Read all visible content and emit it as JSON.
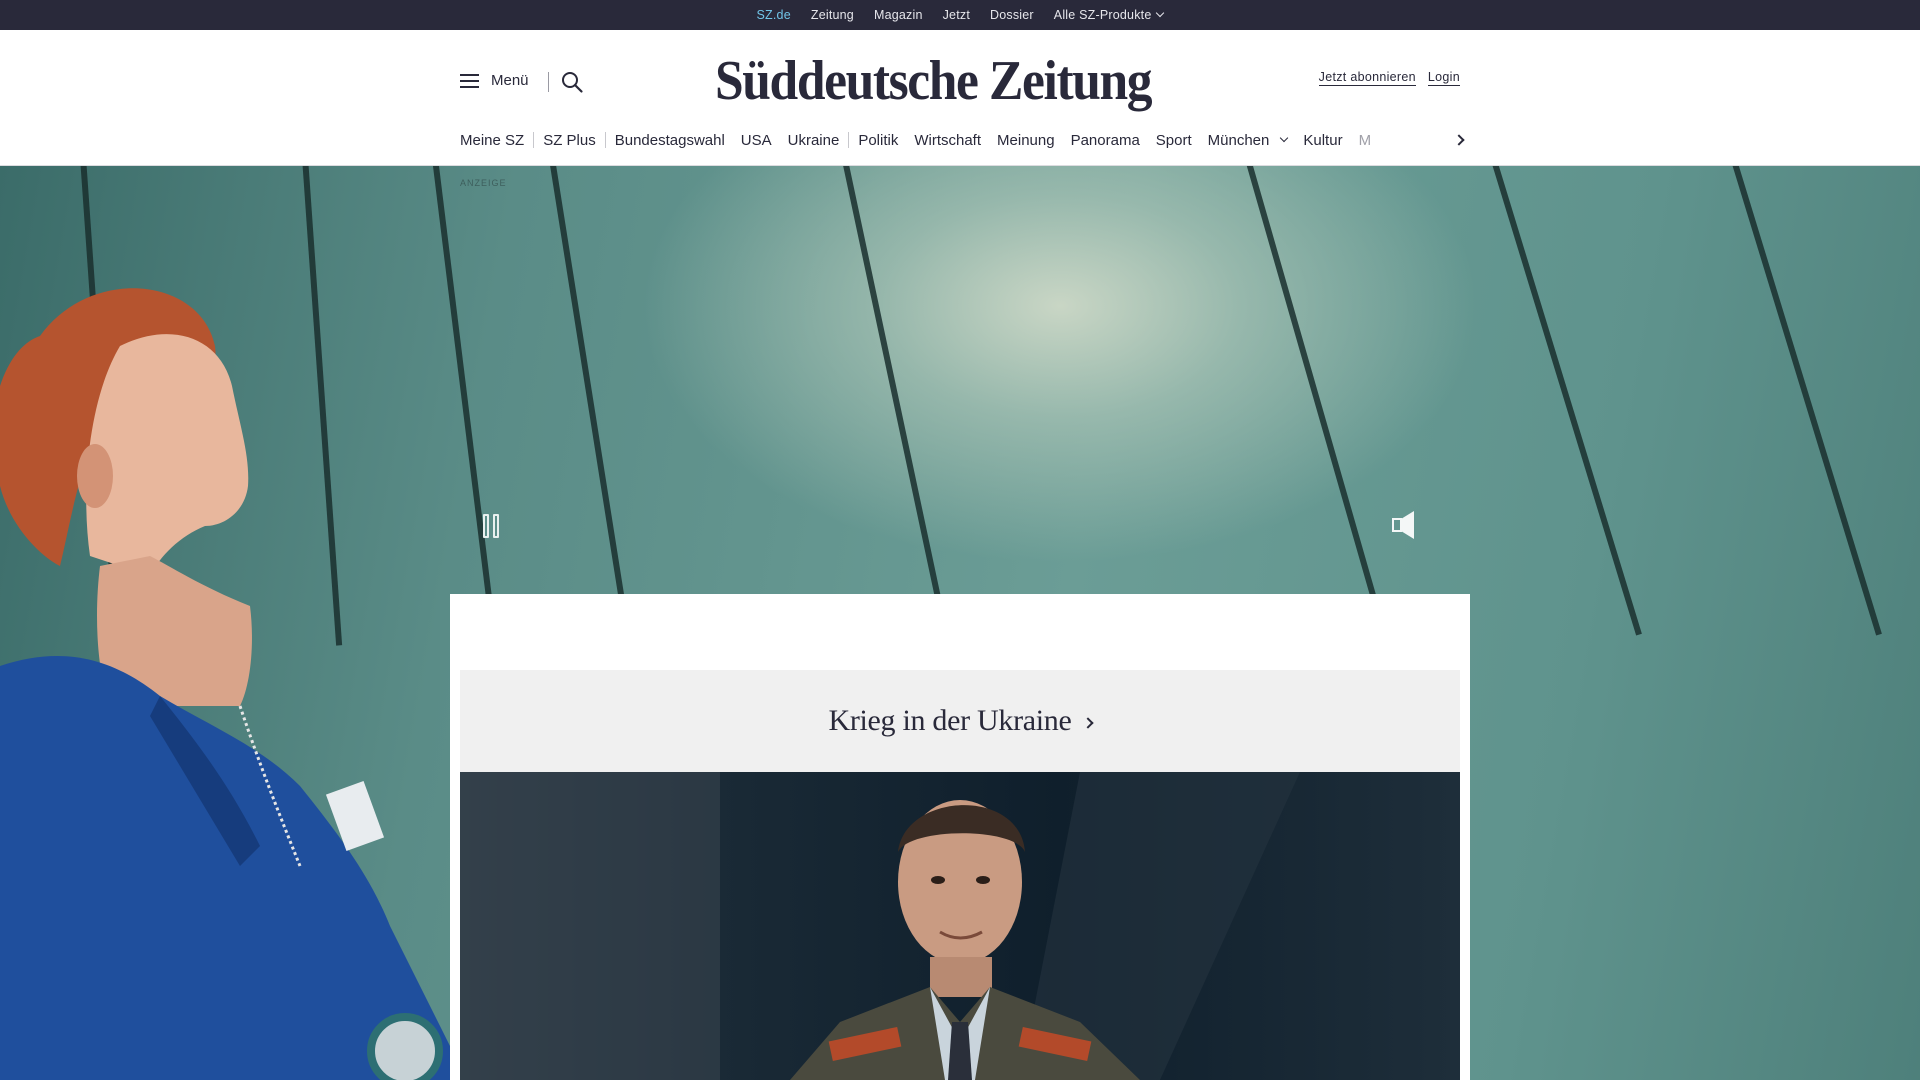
{
  "topbar": {
    "items": [
      {
        "label": "SZ.de",
        "active": true
      },
      {
        "label": "Zeitung"
      },
      {
        "label": "Magazin"
      },
      {
        "label": "Jetzt"
      },
      {
        "label": "Dossier"
      },
      {
        "label": "Alle SZ-Produkte",
        "has_dropdown": true
      }
    ]
  },
  "header": {
    "menu_label": "Menü",
    "logo_text": "Süddeutsche Zeitung",
    "subscribe_label": "Jetzt abonnieren",
    "login_label": "Login"
  },
  "nav": {
    "items": [
      {
        "label": "Meine SZ"
      },
      {
        "label": "SZ Plus"
      },
      {
        "label": "Bundestagswahl"
      },
      {
        "label": "USA"
      },
      {
        "label": "Ukraine"
      },
      {
        "label": "Politik"
      },
      {
        "label": "Wirtschaft"
      },
      {
        "label": "Meinung"
      },
      {
        "label": "Panorama"
      },
      {
        "label": "Sport"
      },
      {
        "label": "München",
        "has_dropdown": true
      },
      {
        "label": "Kultur"
      },
      {
        "label": "M"
      }
    ]
  },
  "hero": {
    "ad_label": "ANZEIGE"
  },
  "card": {
    "section_title": "Krieg in der Ukraine"
  },
  "colors": {
    "topbar_bg": "#29293a",
    "active_link": "#71c5e8",
    "text": "#29293a",
    "section_bg": "#f0f0f0"
  },
  "icons": [
    "hamburger-icon",
    "search-icon",
    "chevron-down-icon",
    "chevron-right-icon",
    "pause-icon",
    "volume-icon"
  ]
}
